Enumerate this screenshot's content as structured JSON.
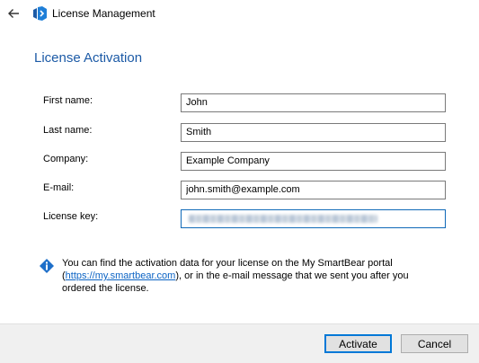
{
  "window": {
    "title": "License Management",
    "back_icon": "back-arrow-icon",
    "logo_icon": "smartbear-logo-icon",
    "accent_color": "#1c5aa6"
  },
  "heading": "License Activation",
  "form": {
    "first_name": {
      "label": "First name:",
      "value": "John"
    },
    "last_name": {
      "label": "Last name:",
      "value": "Smith"
    },
    "company": {
      "label": "Company:",
      "value": "Example Company"
    },
    "email": {
      "label": "E-mail:",
      "value": "john.smith@example.com"
    },
    "license_key": {
      "label": "License key:",
      "value": ""
    }
  },
  "info": {
    "icon": "info-diamond-icon",
    "text_before": "You can find the activation data for your license on the My SmartBear portal (",
    "link_text": "https://my.smartbear.com",
    "text_after": "), or in the e-mail message that we sent you after you ordered the license."
  },
  "buttons": {
    "activate": "Activate",
    "cancel": "Cancel"
  }
}
